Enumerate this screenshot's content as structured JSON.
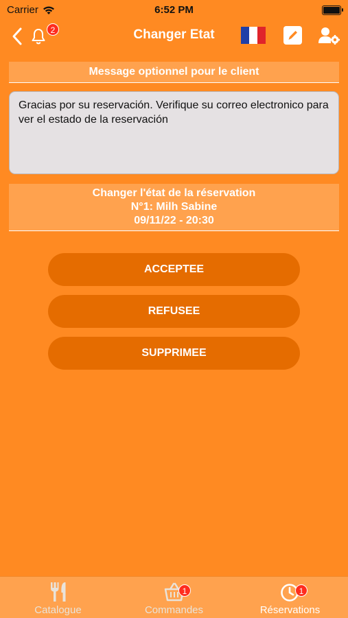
{
  "status_bar": {
    "carrier": "Carrier",
    "time": "6:52 PM"
  },
  "nav": {
    "title": "Changer Etat",
    "notification_count": "2",
    "language_flag": "french-flag"
  },
  "message_section": {
    "header": "Message optionnel pour le client",
    "text": "Gracias por su reservación. Verifique su correo electronico para ver el estado de la reservación"
  },
  "state_section": {
    "title": "Changer l'état de la réservation",
    "reservation": "N°1: Milh Sabine",
    "datetime": "09/11/22 - 20:30"
  },
  "actions": {
    "accept": "ACCEPTEE",
    "refuse": "REFUSEE",
    "delete": "SUPPRIMEE"
  },
  "tabs": [
    {
      "label": "Catalogue",
      "icon": "fork-knife-icon",
      "badge": ""
    },
    {
      "label": "Commandes",
      "icon": "basket-icon",
      "badge": "1"
    },
    {
      "label": "Réservations",
      "icon": "clock-icon",
      "badge": "1",
      "active": true
    }
  ],
  "colors": {
    "background": "#FF8A22",
    "header_band": "#FFA24E",
    "button": "#E56C00",
    "badge": "#FF2D1E"
  }
}
